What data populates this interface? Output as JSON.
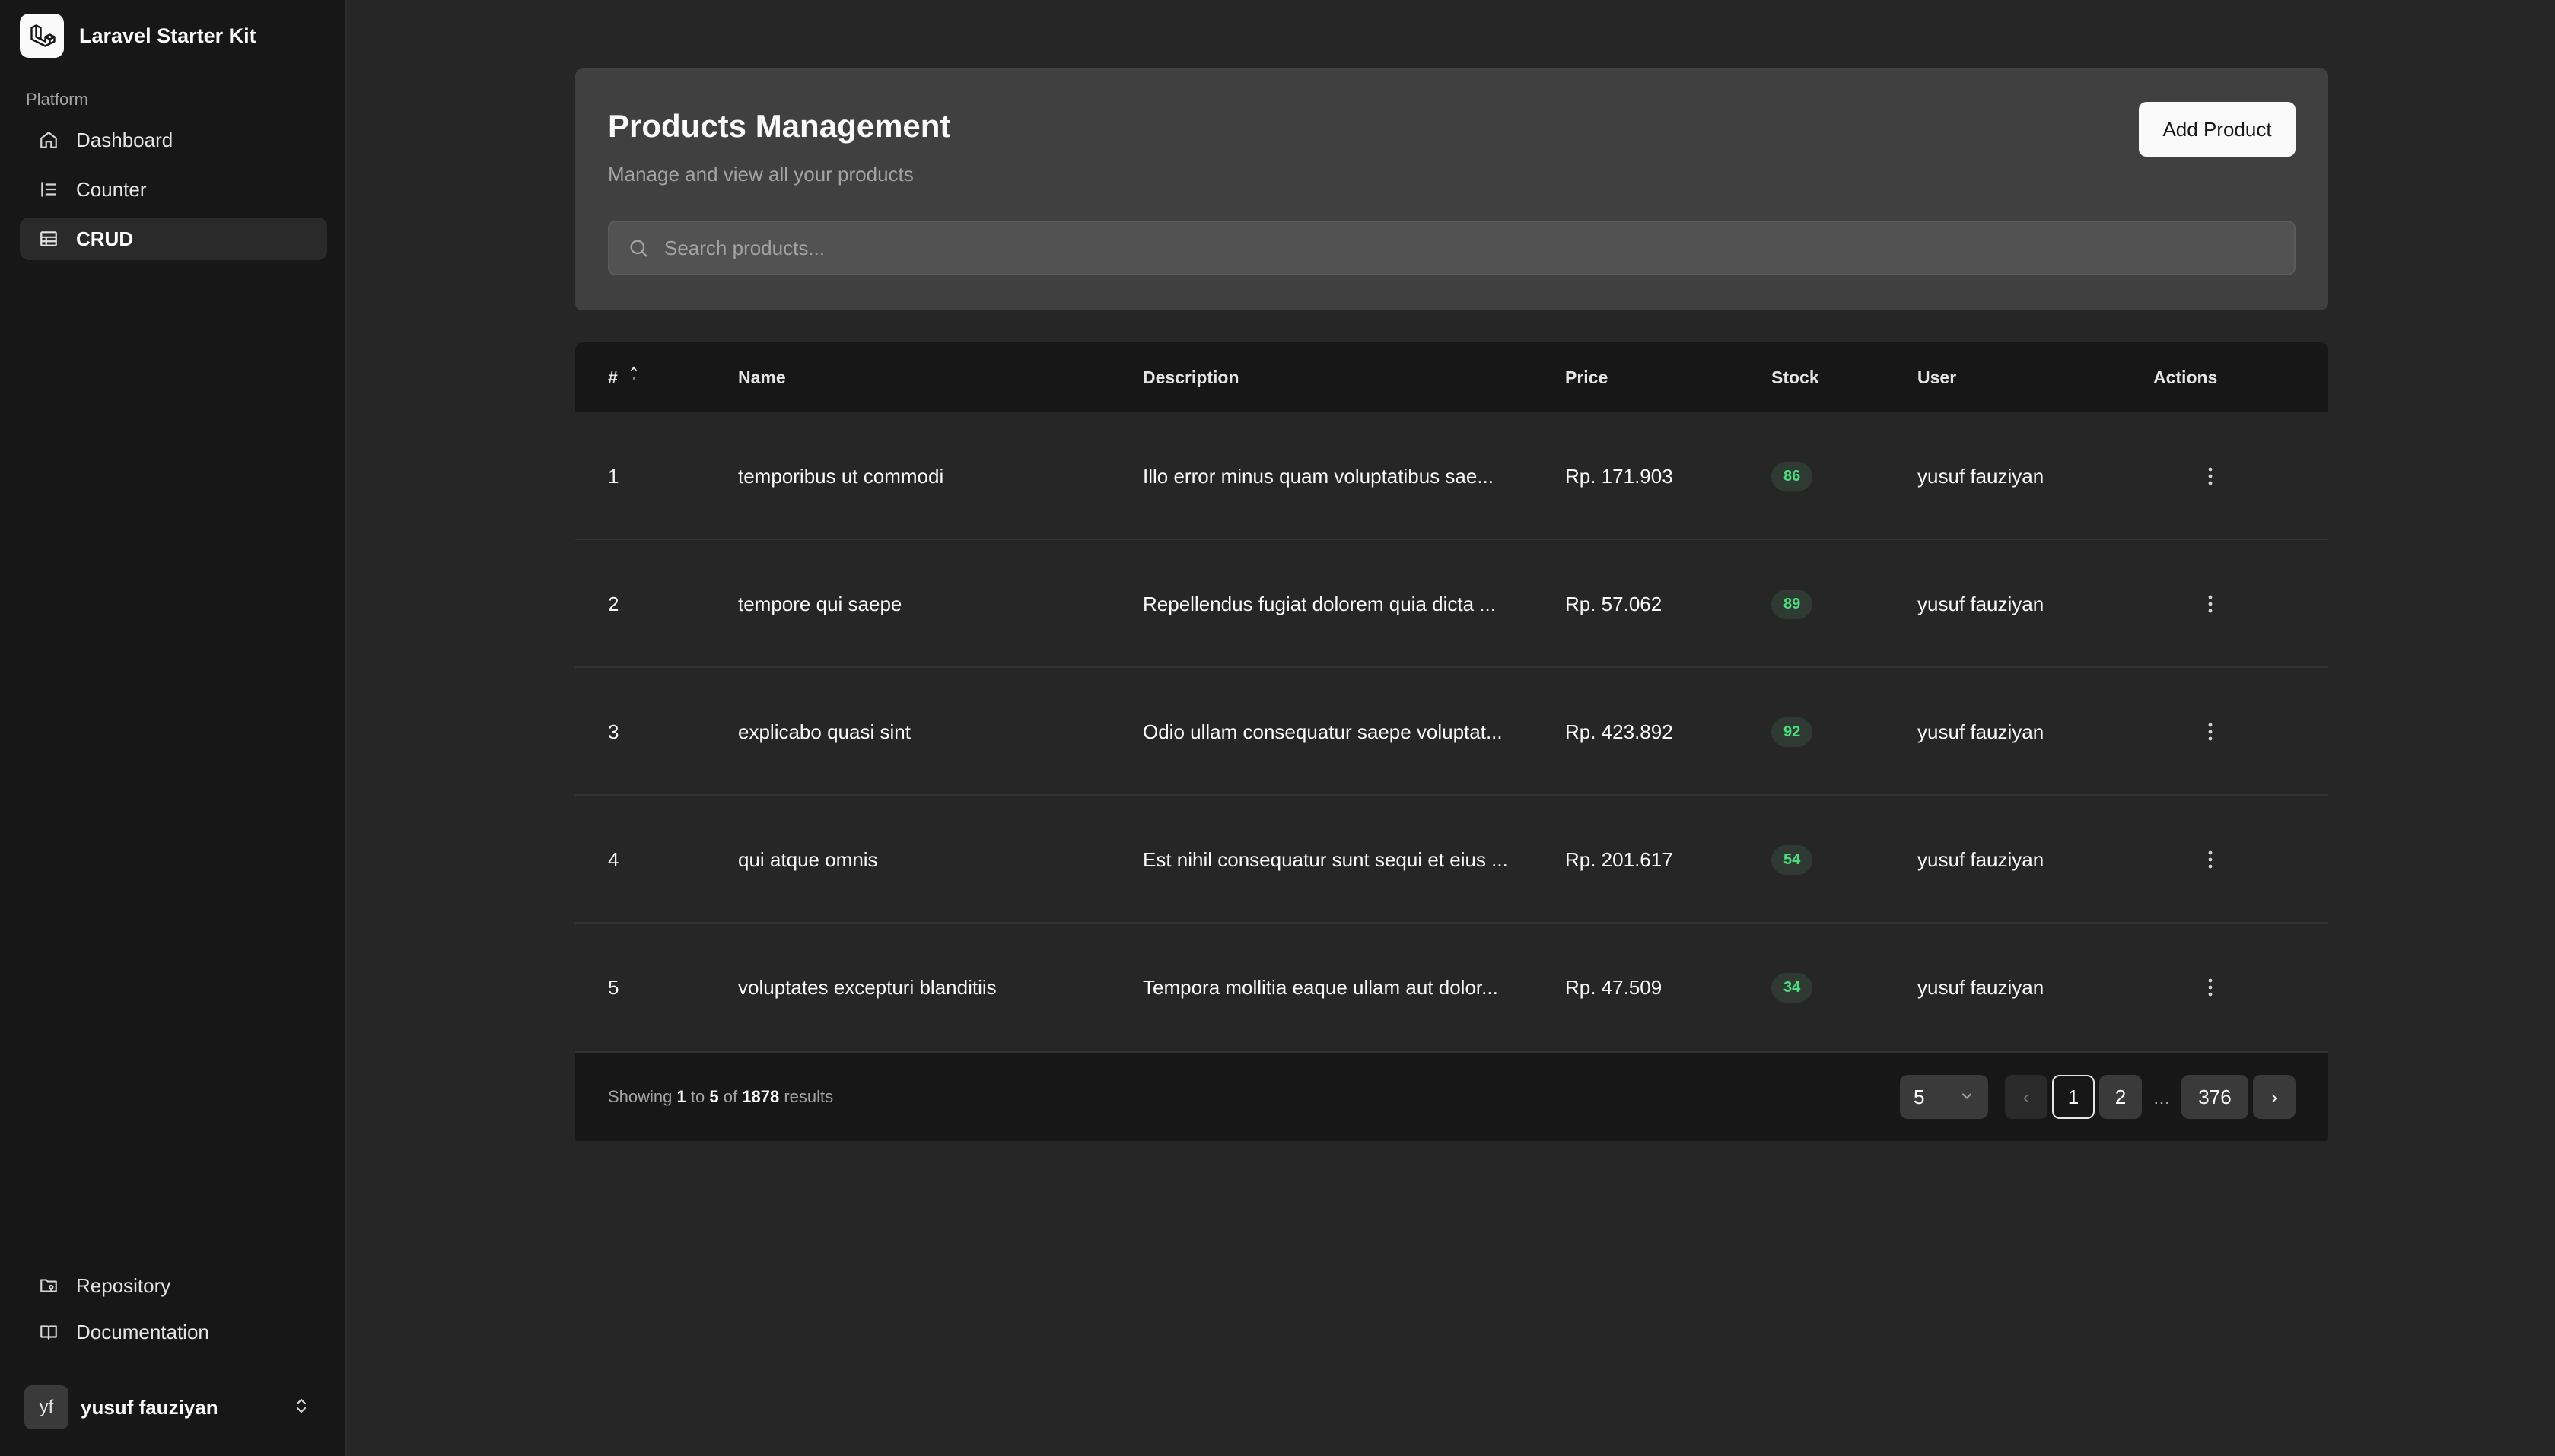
{
  "sidebar": {
    "brand": "Laravel Starter Kit",
    "group_label": "Platform",
    "nav": [
      {
        "label": "Dashboard",
        "icon": "home-icon"
      },
      {
        "label": "Counter",
        "icon": "list-icon"
      },
      {
        "label": "CRUD",
        "icon": "table-icon",
        "active": true
      }
    ],
    "bottom": [
      {
        "label": "Repository",
        "icon": "folder-git-icon"
      },
      {
        "label": "Documentation",
        "icon": "book-icon"
      }
    ],
    "user": {
      "initials": "yf",
      "name": "yusuf fauziyan"
    }
  },
  "header": {
    "title": "Products Management",
    "subtitle": "Manage and view all your products",
    "add_button": "Add Product",
    "search_placeholder": "Search products..."
  },
  "table": {
    "columns": {
      "num": "#",
      "name": "Name",
      "description": "Description",
      "price": "Price",
      "stock": "Stock",
      "user": "User",
      "actions": "Actions"
    },
    "rows": [
      {
        "num": "1",
        "name": "temporibus ut commodi",
        "description": "Illo error minus quam voluptatibus sae...",
        "price": "Rp. 171.903",
        "stock": "86",
        "user": "yusuf fauziyan"
      },
      {
        "num": "2",
        "name": "tempore qui saepe",
        "description": "Repellendus fugiat dolorem quia dicta ...",
        "price": "Rp. 57.062",
        "stock": "89",
        "user": "yusuf fauziyan"
      },
      {
        "num": "3",
        "name": "explicabo quasi sint",
        "description": "Odio ullam consequatur saepe voluptat...",
        "price": "Rp. 423.892",
        "stock": "92",
        "user": "yusuf fauziyan"
      },
      {
        "num": "4",
        "name": "qui atque omnis",
        "description": "Est nihil consequatur sunt sequi et eius ...",
        "price": "Rp. 201.617",
        "stock": "54",
        "user": "yusuf fauziyan"
      },
      {
        "num": "5",
        "name": "voluptates excepturi blanditiis",
        "description": "Tempora mollitia eaque ullam aut dolor...",
        "price": "Rp. 47.509",
        "stock": "34",
        "user": "yusuf fauziyan"
      }
    ]
  },
  "footer": {
    "showing_prefix": "Showing",
    "from": "1",
    "to_word": "to",
    "to": "5",
    "of_word": "of",
    "total": "1878",
    "results_word": "results",
    "per_page": "5",
    "prev": "‹",
    "pages": [
      "1",
      "2"
    ],
    "ellipsis": "...",
    "last_page": "376",
    "next": "›"
  }
}
